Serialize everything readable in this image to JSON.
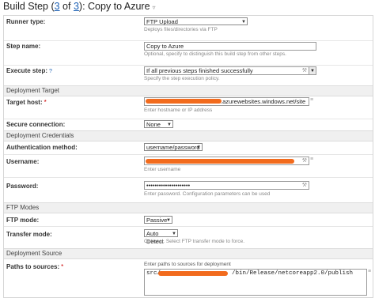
{
  "header": {
    "prefix": "Build Step (",
    "step_current": "3",
    "of": " of ",
    "step_total": "3",
    "suffix": "): Copy to Azure",
    "chevron": "▿"
  },
  "runner_type": {
    "label": "Runner type:",
    "value": "FTP Upload",
    "hint": "Deploys files/directories via FTP"
  },
  "step_name": {
    "label": "Step name:",
    "value": "Copy to Azure",
    "hint": "Optional, specify to distinguish this build step from other steps."
  },
  "execute_step": {
    "label": "Execute step:",
    "help": "?",
    "value": "If all previous steps finished successfully",
    "hint": "Specify the step execution policy."
  },
  "sections": {
    "deployment_target": "Deployment Target",
    "deployment_credentials": "Deployment Credentials",
    "ftp_modes": "FTP Modes",
    "deployment_source": "Deployment Source"
  },
  "target_host": {
    "label": "Target host:",
    "required": "*",
    "value": ".azurewebsites.windows.net/site",
    "hint": "Enter hostname or IP address"
  },
  "secure_connection": {
    "label": "Secure connection:",
    "value": "None"
  },
  "auth_method": {
    "label": "Authentication method:",
    "value": "username/password"
  },
  "username": {
    "label": "Username:",
    "value": "",
    "hint": "Enter username"
  },
  "password": {
    "label": "Password:",
    "value": "•••••••••••••••••••••",
    "hint": "Enter password. Configuration parameters can be used"
  },
  "ftp_mode": {
    "label": "FTP mode:",
    "value": "Passive"
  },
  "transfer_mode": {
    "label": "Transfer mode:",
    "value": "Auto Detect",
    "hint": "Optional. Select FTP transfer mode to force."
  },
  "paths": {
    "label": "Paths to sources:",
    "required": "*",
    "hint": "Enter paths to sources for deployment",
    "value_prefix": "src/",
    "value_suffix": "/bin/Release/netcoreapp2.0/publish"
  },
  "icons": {
    "dropdown": "▼",
    "wrench": "⚒",
    "list": "≡"
  },
  "colors": {
    "link": "#1a5fb4",
    "redaction": "#f26b1d",
    "section_bg": "#f0f0f0",
    "required": "#cc0000"
  }
}
